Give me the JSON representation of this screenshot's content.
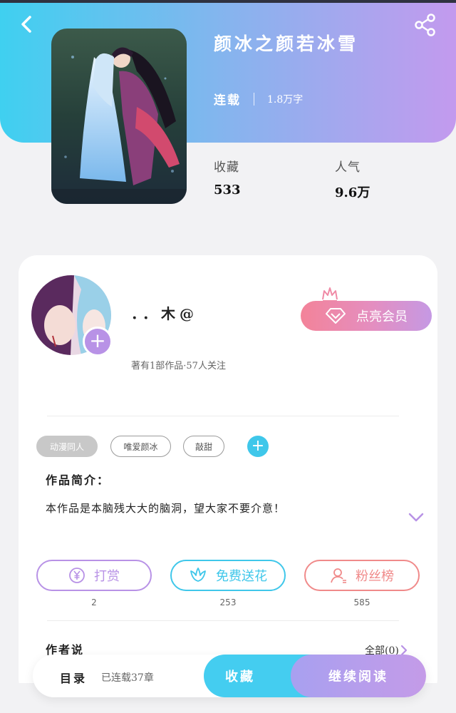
{
  "book": {
    "title": "颜冰之颜若冰雪",
    "status": "连载",
    "word_count": "1.8万字",
    "stats": [
      {
        "label": "收藏",
        "value": "533"
      },
      {
        "label": "人气",
        "value": "9.6万"
      }
    ]
  },
  "icons": {
    "back": "chevron-left-icon",
    "share": "share-icon",
    "vip": "diamond-icon",
    "crown": "crown-icon",
    "reward": "yen-coin-icon",
    "flower": "flower-icon",
    "fans": "user-icon",
    "expand": "chevron-down-icon",
    "more": "chevron-right-icon"
  },
  "author": {
    "name": "．．木@",
    "info": "著有1部作品·57人关注",
    "vip_label": "点亮会员"
  },
  "tags": [
    "动漫同人",
    "唯爱颜冰",
    "敲甜"
  ],
  "intro": {
    "title": "作品简介：",
    "text": "本作品是本脑残大大的脑洞，望大家不要介意！"
  },
  "actions": [
    {
      "label": "打赏",
      "count": "2",
      "color": "#b892e6"
    },
    {
      "label": "免费送花",
      "count": "253",
      "color": "#3fc7ea"
    },
    {
      "label": "粉丝榜",
      "count": "585",
      "color": "#f08a8a"
    }
  ],
  "author_says": {
    "title": "作者说",
    "all_label": "全部(0)"
  },
  "bottom_bar": {
    "catalog_label": "目录",
    "chapters": "已连载37章",
    "collect_label": "收藏",
    "read_label": "继续阅读"
  },
  "colors": {
    "accent_blue": "#3fc7ea",
    "accent_purple": "#b892e6",
    "vip_pink": "#f38399"
  }
}
